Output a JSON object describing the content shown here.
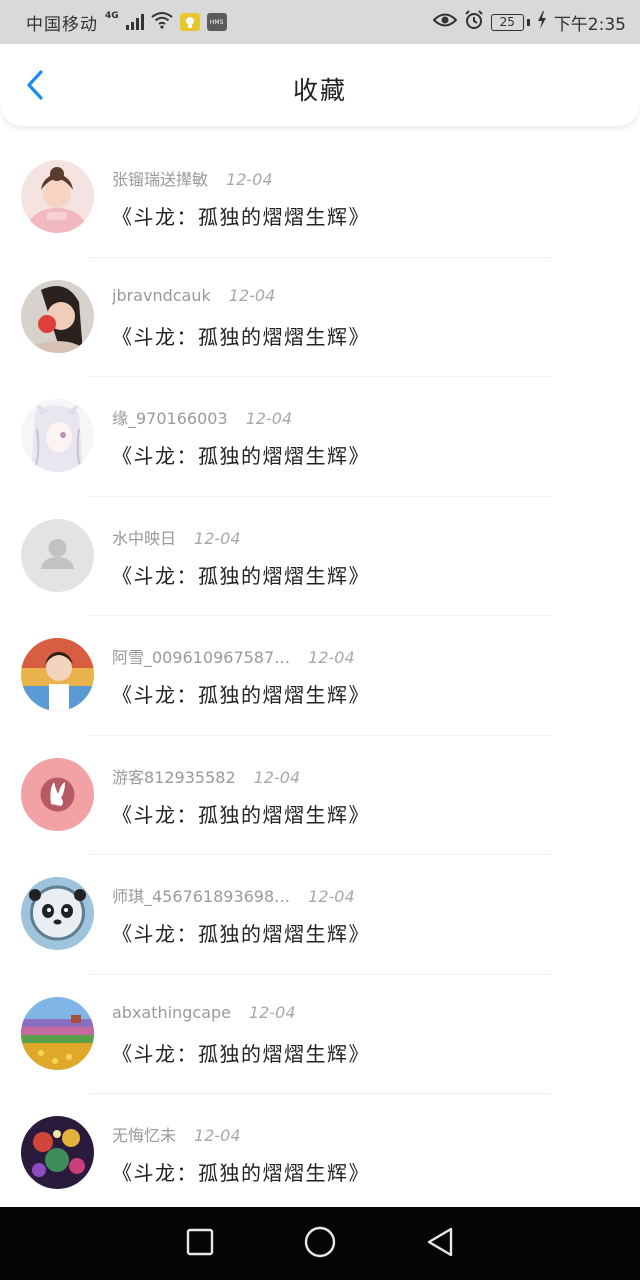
{
  "status_bar": {
    "carrier": "中国移动",
    "network_type": "4G",
    "icons": [
      "signal-icon",
      "wifi-icon",
      "app-notification-icon",
      "hms-icon",
      "eye-comfort-icon",
      "alarm-icon",
      "battery-icon",
      "charging-icon"
    ],
    "hms_label": "HMS",
    "battery_level": "25",
    "time": "下午2:35"
  },
  "header": {
    "title": "收藏",
    "back_icon": "chevron-left-icon",
    "accent_color": "#1a8cf0"
  },
  "favorites": [
    {
      "username": "张镏瑞送撵敏",
      "date": "12-04",
      "book": "《斗龙：孤独的熠熠生辉》",
      "avatar": "girl-pink-sweater"
    },
    {
      "username": "jbravndcauk",
      "date": "12-04",
      "book": "《斗龙：孤独的熠熠生辉》",
      "avatar": "girl-with-flower"
    },
    {
      "username": "缘_970166003",
      "date": "12-04",
      "book": "《斗龙：孤独的熠熠生辉》",
      "avatar": "anime-white-hair"
    },
    {
      "username": "水中映日",
      "date": "12-04",
      "book": "《斗龙：孤独的熠熠生辉》",
      "avatar": "default-person"
    },
    {
      "username": "阿雪_009610967587…",
      "date": "12-04",
      "book": "《斗龙：孤独的熠熠生辉》",
      "avatar": "little-girl"
    },
    {
      "username": "游客812935582",
      "date": "12-04",
      "book": "《斗龙：孤独的熠熠生辉》",
      "avatar": "pink-rabbit-logo"
    },
    {
      "username": "师琪_456761893698…",
      "date": "12-04",
      "book": "《斗龙：孤独的熠熠生辉》",
      "avatar": "astronaut-panda"
    },
    {
      "username": "abxathingcape",
      "date": "12-04",
      "book": "《斗龙：孤独的熠熠生辉》",
      "avatar": "flower-field"
    },
    {
      "username": "无悔忆未",
      "date": "12-04",
      "book": "《斗龙：孤独的熠熠生辉》",
      "avatar": "colorful-fantasy"
    }
  ],
  "nav_bar": {
    "icons": [
      "recent-apps-icon",
      "home-icon",
      "back-triangle-icon"
    ]
  }
}
